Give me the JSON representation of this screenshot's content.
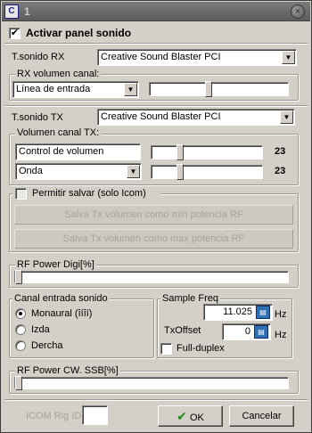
{
  "window": {
    "title": "1",
    "app_icon": "window-app-icon",
    "close_icon": "close-icon"
  },
  "activar": {
    "label": "Activar panel sonido",
    "checked": true
  },
  "rx": {
    "tsonido_label": "T.sonido RX",
    "device": "Creative Sound Blaster PCI",
    "vol_group_title": "RX volumen canal:",
    "input": "Línea de entrada",
    "level": 0.47
  },
  "tx": {
    "tsonido_label": "T.sonido TX",
    "device": "Creative Sound Blaster PCI",
    "vol_group_title": "Volumen canal TX:",
    "ctrl_field": "Control de volumen",
    "ctrl_value": "23",
    "ctrl_level": 0.22,
    "mode": "Onda",
    "mode_value": "23",
    "mode_level": 0.22
  },
  "permitir": {
    "label": "Permitir salvar (solo Icom)",
    "btn_min": "Salva Tx volumen como min potencia RF",
    "btn_max": "Salva Tx volumen como max potencia RF"
  },
  "rf_digi": {
    "title": "RF Power Digi[%]",
    "level": 0.0
  },
  "canal": {
    "title": "Canal entrada sonido",
    "options": [
      "Monaural (îíîí)",
      "Izda",
      "Dercha"
    ],
    "selected": 0
  },
  "sample": {
    "title": "Sample Freq",
    "freq": "11.025",
    "unit": "Hz",
    "txoffset_label": "TxOffset",
    "txoffset": "0",
    "fullduplex_label": "Full-duplex"
  },
  "rf_cw": {
    "title": "RF Power CW. SSB[%]",
    "level": 0.0
  },
  "footer": {
    "icom_label": "ICOM Rig ID",
    "icom_value": "",
    "ok_label": "OK",
    "cancel_label": "Cancelar"
  }
}
